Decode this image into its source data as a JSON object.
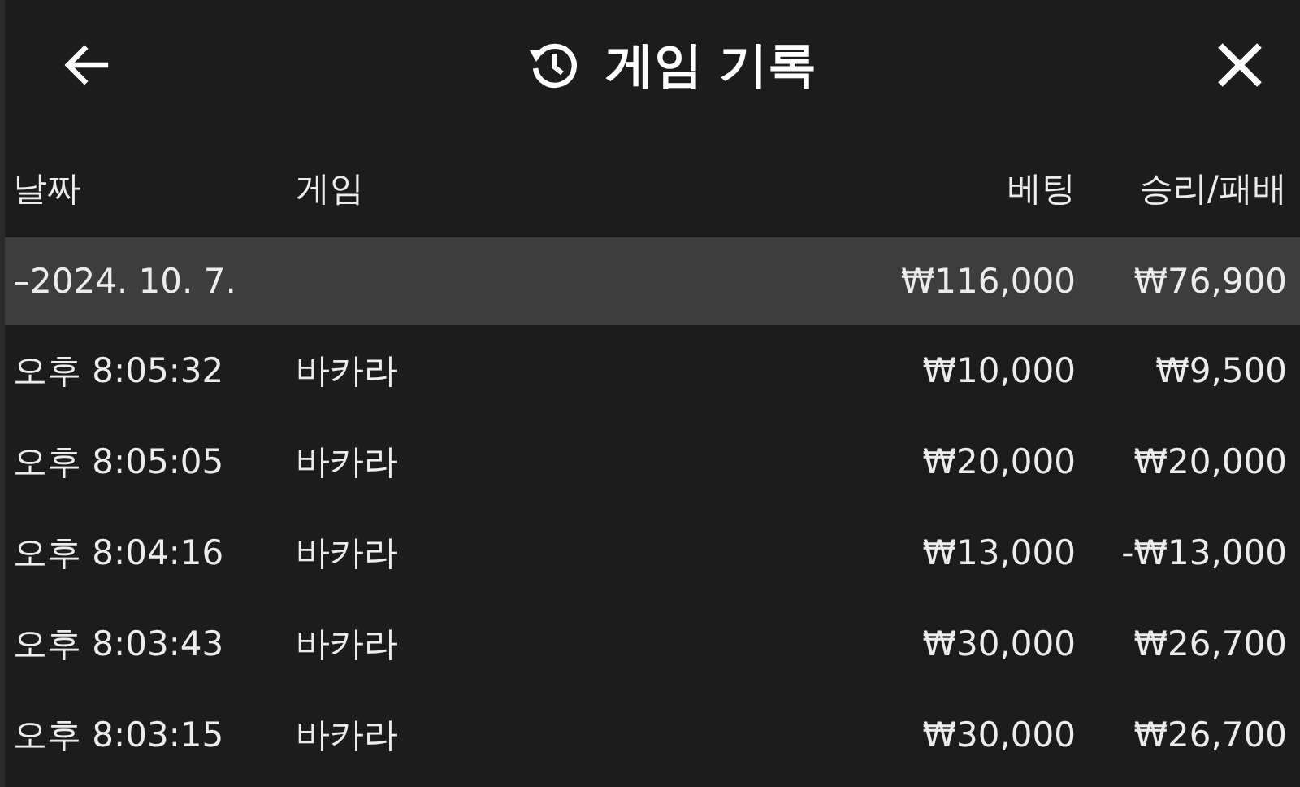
{
  "header": {
    "title": "게임 기록"
  },
  "table": {
    "columns": [
      "날짜",
      "게임",
      "베팅",
      "승리/패배"
    ],
    "group": {
      "date": "–2024. 10. 7.",
      "bet": "₩116,000",
      "result": "₩76,900"
    },
    "rows": [
      {
        "time": "오후 8:05:32",
        "game": "바카라",
        "bet": "₩10,000",
        "result": "₩9,500"
      },
      {
        "time": "오후 8:05:05",
        "game": "바카라",
        "bet": "₩20,000",
        "result": "₩20,000"
      },
      {
        "time": "오후 8:04:16",
        "game": "바카라",
        "bet": "₩13,000",
        "result": "-₩13,000"
      },
      {
        "time": "오후 8:03:43",
        "game": "바카라",
        "bet": "₩30,000",
        "result": "₩26,700"
      },
      {
        "time": "오후 8:03:15",
        "game": "바카라",
        "bet": "₩30,000",
        "result": "₩26,700"
      }
    ]
  }
}
